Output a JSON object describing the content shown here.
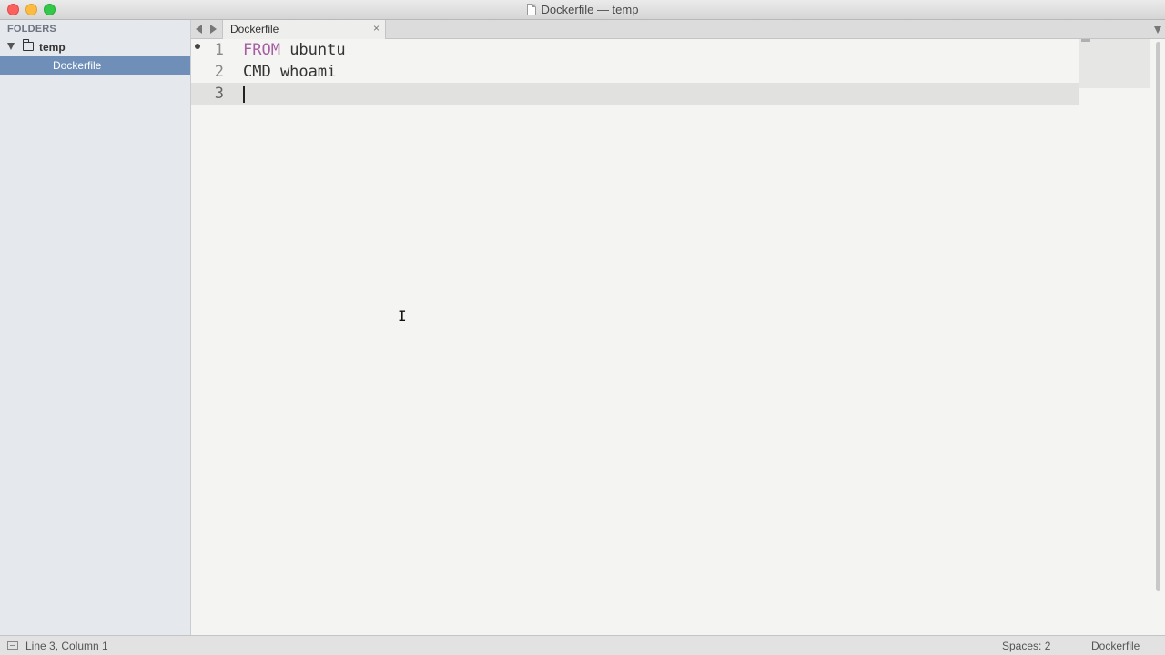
{
  "window": {
    "title": "Dockerfile — temp"
  },
  "sidebar": {
    "header": "FOLDERS",
    "folder": {
      "name": "temp",
      "expanded": true
    },
    "files": [
      {
        "name": "Dockerfile",
        "selected": true
      }
    ]
  },
  "tabs": [
    {
      "label": "Dockerfile",
      "close": "×",
      "active": true
    }
  ],
  "editor": {
    "lines": [
      {
        "number": "1",
        "keyword": "FROM",
        "rest": " ubuntu",
        "modified": true
      },
      {
        "number": "2",
        "keyword": "",
        "rest": "CMD whoami",
        "modified": false
      },
      {
        "number": "3",
        "keyword": "",
        "rest": "",
        "modified": false,
        "current": true
      }
    ],
    "keyword_color": "#a65ea3"
  },
  "statusbar": {
    "position": "Line 3, Column 1",
    "indentation": "Spaces: 2",
    "syntax": "Dockerfile"
  },
  "cursor_glyph": "I"
}
